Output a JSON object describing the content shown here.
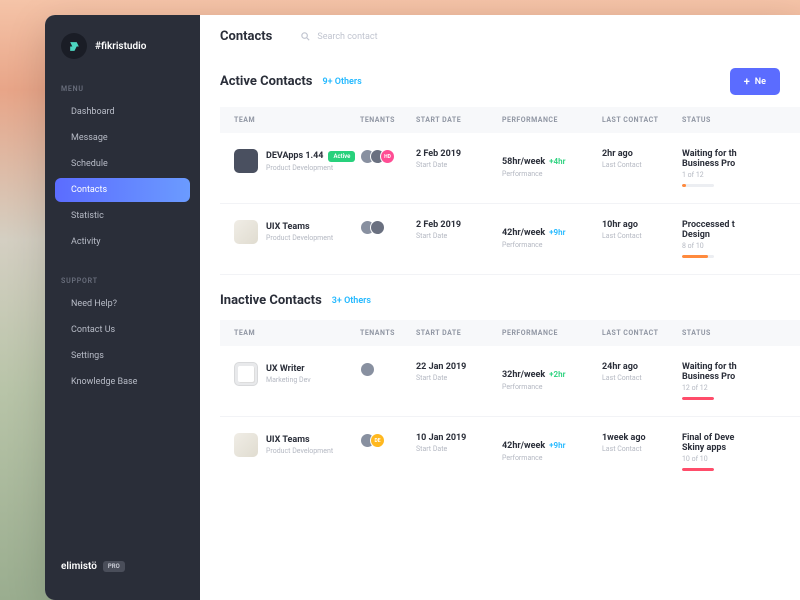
{
  "workspace": {
    "name": "#fikristudio"
  },
  "sidebar": {
    "menu_label": "MENU",
    "support_label": "SUPPORT",
    "menu": [
      {
        "label": "Dashboard"
      },
      {
        "label": "Message"
      },
      {
        "label": "Schedule"
      },
      {
        "label": "Contacts"
      },
      {
        "label": "Statistic"
      },
      {
        "label": "Activity"
      }
    ],
    "support": [
      {
        "label": "Need Help?"
      },
      {
        "label": "Contact Us"
      },
      {
        "label": "Settings"
      },
      {
        "label": "Knowledge Base"
      }
    ]
  },
  "brand": {
    "name": "elimistö",
    "badge": "PRO"
  },
  "page": {
    "title": "Contacts"
  },
  "search": {
    "placeholder": "Search contact"
  },
  "ui": {
    "new_button": "Ne",
    "col_team": "TEAM",
    "col_tenants": "TENANTS",
    "col_start": "START DATE",
    "col_perf": "PERFORMANCE",
    "col_last": "LAST CONTACT",
    "col_status": "STATUS",
    "sub_start": "Start Date",
    "sub_perf": "Performance",
    "sub_last": "Last Contact",
    "badge_active": "Active"
  },
  "sections": {
    "active": {
      "title": "Active Contacts",
      "others": "9+ Others"
    },
    "inactive": {
      "title": "Inactive Contacts",
      "others": "3+ Others"
    }
  },
  "active_rows": [
    {
      "team": "DEVApps 1.44",
      "sub": "Product Development",
      "active": true,
      "start": "2 Feb 2019",
      "perf": "58hr/week",
      "delta": "+4hr",
      "delta_style": "green",
      "last": "2hr ago",
      "status_line1": "Waiting for th",
      "status_line2": "Business Pro",
      "status_count": "1 of 12",
      "progress": 12,
      "progress_color": "orange",
      "tenants_extra": "HD",
      "tenants_extra_color": "pink"
    },
    {
      "team": "UIX Teams",
      "sub": "Product Development",
      "active": false,
      "start": "2 Feb 2019",
      "perf": "42hr/week",
      "delta": "+9hr",
      "delta_style": "blue",
      "last": "10hr ago",
      "status_line1": "Proccessed t",
      "status_line2": "Design",
      "status_count": "8 of 10",
      "progress": 80,
      "progress_color": "orange",
      "tenants_extra": null
    }
  ],
  "inactive_rows": [
    {
      "team": "UX Writer",
      "sub": "Marketing Dev",
      "avatar_style": "paper",
      "start": "22 Jan 2019",
      "perf": "32hr/week",
      "delta": "+2hr",
      "delta_style": "green",
      "last": "24hr ago",
      "status_line1": "Waiting for th",
      "status_line2": "Business Pro",
      "status_count": "12 of 12",
      "progress": 100,
      "progress_color": "red",
      "tenants_count": 1
    },
    {
      "team": "UIX Teams",
      "sub": "Product Development",
      "avatar_style": "script",
      "start": "10 Jan 2019",
      "perf": "42hr/week",
      "delta": "+9hr",
      "delta_style": "blue",
      "last": "1week ago",
      "status_line1": "Final of Deve",
      "status_line2": "Skiny apps",
      "status_count": "10 of 10",
      "progress": 100,
      "progress_color": "red",
      "tenants_extra": "DE",
      "tenants_extra_color": "yellow"
    }
  ]
}
